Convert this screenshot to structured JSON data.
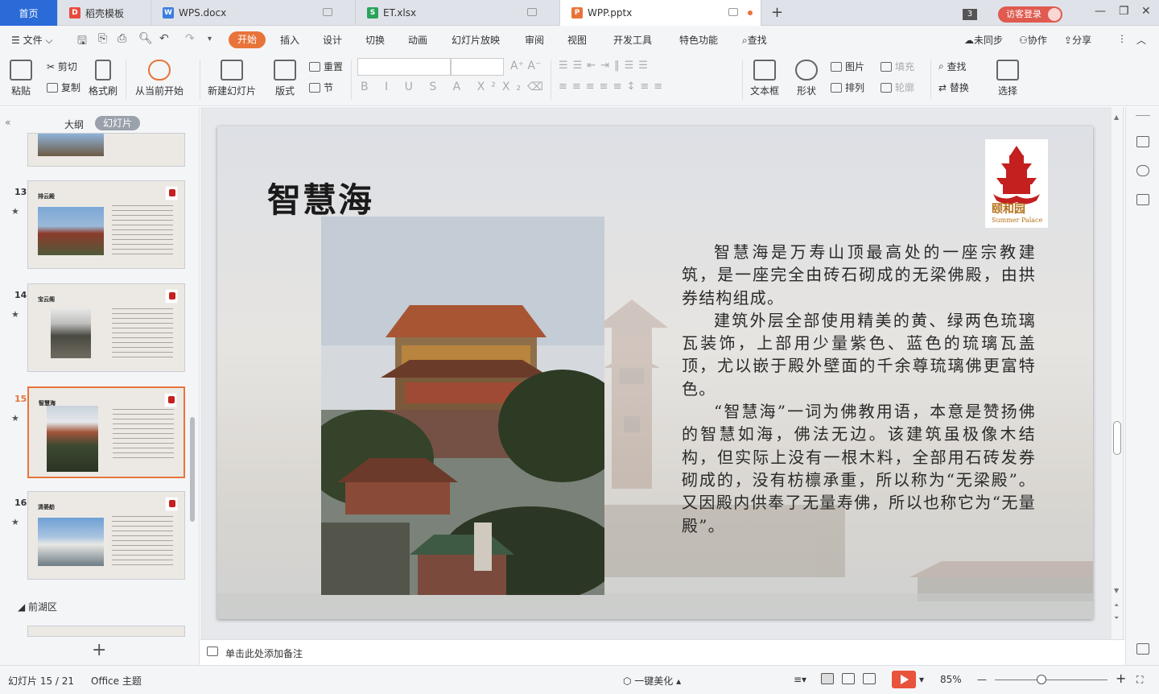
{
  "tabs": [
    {
      "label": "首页"
    },
    {
      "label": "稻壳模板"
    },
    {
      "label": "WPS.docx"
    },
    {
      "label": "ET.xlsx"
    },
    {
      "label": "WPP.pptx"
    }
  ],
  "titlebar": {
    "new_tab": "+",
    "tab_count": "3",
    "login": "访客登录"
  },
  "menu": {
    "file": "文件",
    "items": [
      "开始",
      "插入",
      "设计",
      "切换",
      "动画",
      "幻灯片放映",
      "审阅",
      "视图",
      "开发工具",
      "特色功能"
    ],
    "search": "查找",
    "unsynced": "未同步",
    "collaborate": "协作",
    "share": "分享"
  },
  "ribbon": {
    "paste": "粘贴",
    "cut": "剪切",
    "copy": "复制",
    "format_painter": "格式刷",
    "from_current": "从当前开始",
    "new_slide": "新建幻灯片",
    "layout": "版式",
    "reset": "重置",
    "section": "节",
    "textbox": "文本框",
    "shape": "形状",
    "picture": "图片",
    "fill": "填充",
    "arrange": "排列",
    "outline": "轮廓",
    "find": "查找",
    "replace": "替换",
    "select": "选择"
  },
  "sidebar": {
    "outline_tab": "大纲",
    "slides_tab": "幻灯片",
    "thumbs": [
      {
        "num": "13",
        "title": "排云殿"
      },
      {
        "num": "14",
        "title": "宝云阁"
      },
      {
        "num": "15",
        "title": "智慧海"
      },
      {
        "num": "16",
        "title": "清晏舫"
      }
    ],
    "section": "前湖区",
    "add": "+"
  },
  "slide": {
    "title": "智慧海",
    "logo_text": "颐和园",
    "logo_sub": "Summer Palace",
    "paragraphs": [
      "智慧海是万寿山顶最高处的一座宗教建筑，是一座完全由砖石砌成的无梁佛殿，由拱券结构组成。",
      "建筑外层全部使用精美的黄、绿两色琉璃瓦装饰，上部用少量紫色、蓝色的琉璃瓦盖顶，尤以嵌于殿外壁面的千余尊琉璃佛更富特色。",
      "“智慧海”一词为佛教用语，本意是赞扬佛的智慧如海，佛法无边。该建筑虽极像木结构，但实际上没有一根木料，全部用石砖发券砌成的，没有枋檩承重，所以称为“无梁殿”。又因殿内供奉了无量寿佛，所以也称它为“无量殿”。"
    ]
  },
  "notes": {
    "placeholder": "单击此处添加备注"
  },
  "status": {
    "slide_counter": "幻灯片 15 / 21",
    "theme": "Office 主题",
    "beautify": "一键美化",
    "zoom": "85%"
  },
  "colors": {
    "accent": "#e8743b",
    "home_tab": "#2a6bd8",
    "login": "#e05a4f",
    "logo_red": "#c3201f"
  }
}
